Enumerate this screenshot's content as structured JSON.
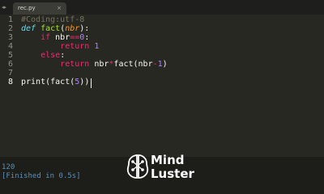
{
  "tab": {
    "nav_glyph": "◂▸",
    "filename": "rec.py",
    "close": "×"
  },
  "editor": {
    "line_numbers": [
      "1",
      "2",
      "3",
      "4",
      "5",
      "6",
      "7",
      "8"
    ],
    "active_line": "8",
    "lines": [
      {
        "t1": "#Coding:utf-8"
      },
      {
        "kw": "def",
        "name": "fact",
        "open": "(",
        "param": "nbr",
        "close": "):"
      },
      {
        "indent": "    ",
        "kw": "if",
        "a": " nbr",
        "op": "==",
        "num": "0",
        "end": ":"
      },
      {
        "indent": "        ",
        "kw": "return",
        "num": " 1"
      },
      {
        "indent": "    ",
        "kw": "else",
        "end": ":"
      },
      {
        "indent": "        ",
        "kw": "return",
        "a": " nbr",
        "op": "*",
        "b": "fact(nbr",
        "op2": "-",
        "num": "1",
        "end": ")"
      },
      {},
      {
        "call": "print",
        "open": "(",
        "inner": "fact",
        "open2": "(",
        "num": "5",
        "close": "))"
      }
    ]
  },
  "output": {
    "result": "120",
    "finished": "[Finished in 0.5s]"
  },
  "watermark": {
    "line1": "Mind",
    "line2": "Luster"
  },
  "colors": {
    "background": "#272822",
    "keyword": "#f92672",
    "storage": "#66d9ef",
    "function": "#a6e22e",
    "parameter": "#fd971f",
    "number": "#ae81ff",
    "comment": "#75715e",
    "output_text": "#5c8fb8"
  }
}
